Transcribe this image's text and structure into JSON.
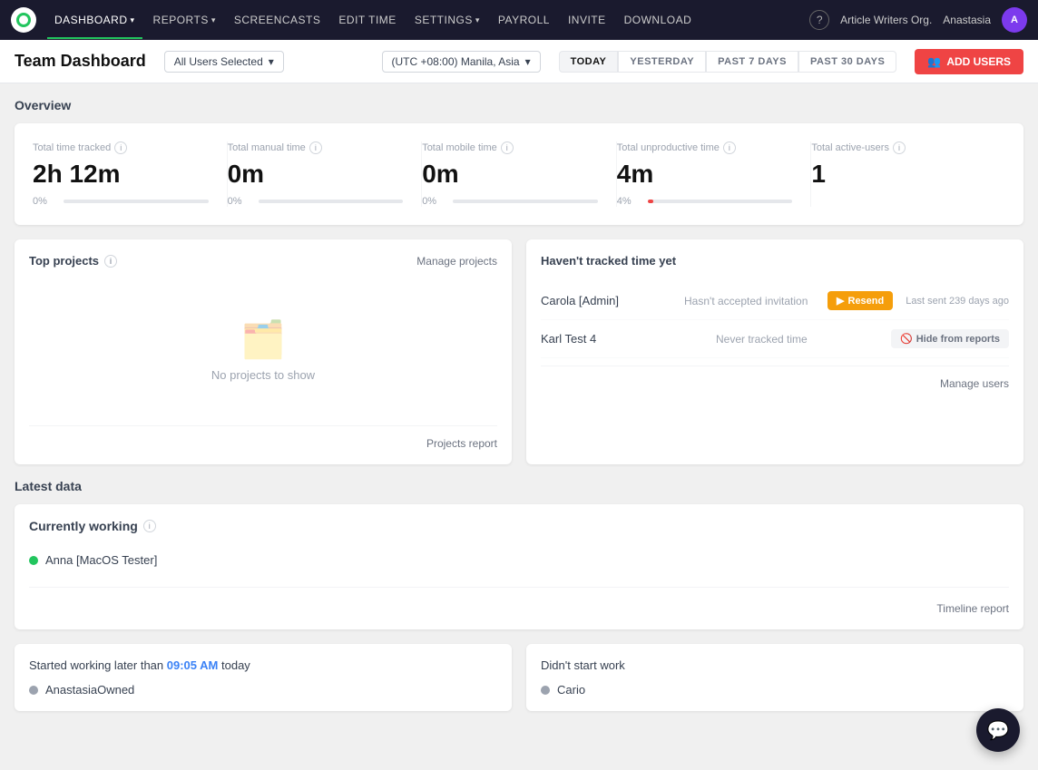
{
  "nav": {
    "items": [
      {
        "label": "DASHBOARD",
        "active": true,
        "hasChevron": true
      },
      {
        "label": "REPORTS",
        "active": false,
        "hasChevron": true
      },
      {
        "label": "SCREENCASTS",
        "active": false,
        "hasChevron": false
      },
      {
        "label": "EDIT TIME",
        "active": false,
        "hasChevron": false
      },
      {
        "label": "SETTINGS",
        "active": false,
        "hasChevron": true
      },
      {
        "label": "PAYROLL",
        "active": false,
        "hasChevron": false
      },
      {
        "label": "INVITE",
        "active": false,
        "hasChevron": false
      },
      {
        "label": "DOWNLOAD",
        "active": false,
        "hasChevron": false
      }
    ],
    "org": "Article Writers Org.",
    "user": "Anastasia",
    "user_initial": "A",
    "help_label": "?"
  },
  "subheader": {
    "page_title": "Team Dashboard",
    "user_filter": "All Users Selected",
    "timezone": "(UTC +08:00) Manila, Asia",
    "date_buttons": [
      "TODAY",
      "YESTERDAY",
      "PAST 7 DAYS",
      "PAST 30 DAYS"
    ],
    "active_date": "TODAY",
    "add_users_label": "ADD USERS"
  },
  "overview": {
    "section_title": "Overview",
    "stats": [
      {
        "label": "Total time tracked",
        "value": "2h 12m",
        "pct": "0%",
        "bar_fill": 0,
        "bar_color": "#3b82f6"
      },
      {
        "label": "Total manual time",
        "value": "0m",
        "pct": "0%",
        "bar_fill": 0,
        "bar_color": "#3b82f6"
      },
      {
        "label": "Total mobile time",
        "value": "0m",
        "pct": "0%",
        "bar_fill": 0,
        "bar_color": "#3b82f6",
        "has_info": true
      },
      {
        "label": "Total unproductive time",
        "value": "4m",
        "pct": "4%",
        "bar_fill": 4,
        "bar_color": "#ef4444",
        "has_info": true
      },
      {
        "label": "Total active-users",
        "value": "1",
        "has_info": true,
        "show_bar": false
      }
    ]
  },
  "top_projects": {
    "title": "Top projects",
    "manage_link": "Manage projects",
    "empty_text": "No projects to show",
    "footer_link": "Projects report"
  },
  "havent_tracked": {
    "title": "Haven't tracked time yet",
    "rows": [
      {
        "name": "Carola [Admin]",
        "status": "Hasn't accepted invitation",
        "action": "resend",
        "action_label": "Resend",
        "last_sent_label": "Last sent 239 days ago"
      },
      {
        "name": "Karl Test 4",
        "status": "Never tracked time",
        "action": "hide",
        "action_label": "Hide from reports"
      }
    ],
    "footer_link": "Manage users"
  },
  "latest_data": {
    "section_title": "Latest data",
    "currently_working_title": "Currently working",
    "users": [
      {
        "name": "Anna [MacOS Tester]",
        "status": "active"
      }
    ],
    "timeline_link": "Timeline report"
  },
  "bottom_cards": {
    "started_later": {
      "title_prefix": "Started working later than",
      "time": "09:05 AM",
      "title_suffix": "today",
      "users": [
        {
          "name": "AnastasiaOwned",
          "status": "gray"
        }
      ]
    },
    "didnt_start": {
      "title": "Didn't start work",
      "users": [
        {
          "name": "Cario",
          "status": "gray"
        }
      ]
    }
  },
  "chat_btn_label": "💬"
}
